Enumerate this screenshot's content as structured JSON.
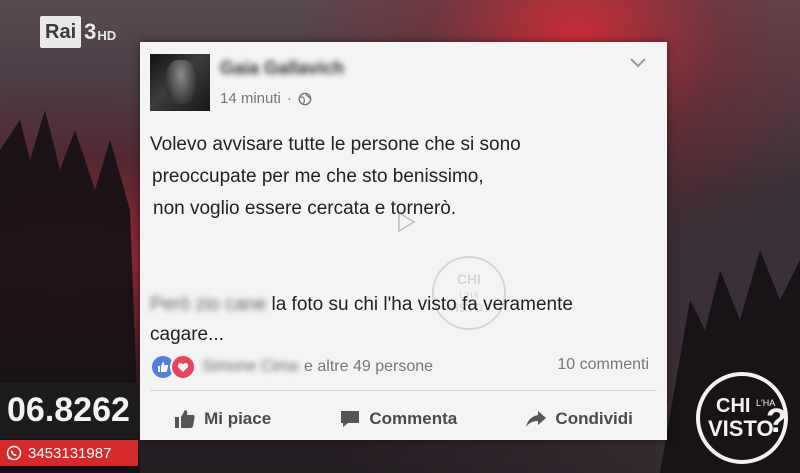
{
  "channel": {
    "name": "Rai",
    "number": "3",
    "hd": "HD"
  },
  "post": {
    "author": "Gaia Gallavich",
    "time": "14 minuti",
    "separator": "·",
    "lines": [
      "Volevo avvisare tutte le persone che si sono",
      "preoccupate per me che sto benissimo,",
      "non voglio essere cercata e tornerò."
    ],
    "comment_author": "Però zio cane",
    "comment_lines": [
      "la foto su chi l'ha visto fa veramente",
      "cagare..."
    ],
    "reactions_name": "Simone Cima",
    "reactions_others": "e altre 49 persone",
    "comments_count": "10 commenti",
    "actions": {
      "like": "Mi piace",
      "comment": "Commenta",
      "share": "Condividi"
    }
  },
  "watermark": {
    "line1": "CHI",
    "line2": "L'HA",
    "line3": "VISTO?"
  },
  "phone": {
    "number": "06.8262",
    "whatsapp": "3453131987"
  },
  "show_logo": {
    "line1": "CHI",
    "line2": "L'HA",
    "line3": "VISTO"
  },
  "colors": {
    "like_blue": "#4f7fe0",
    "love_red": "#e8455c",
    "sms_red": "#d62a2a"
  }
}
